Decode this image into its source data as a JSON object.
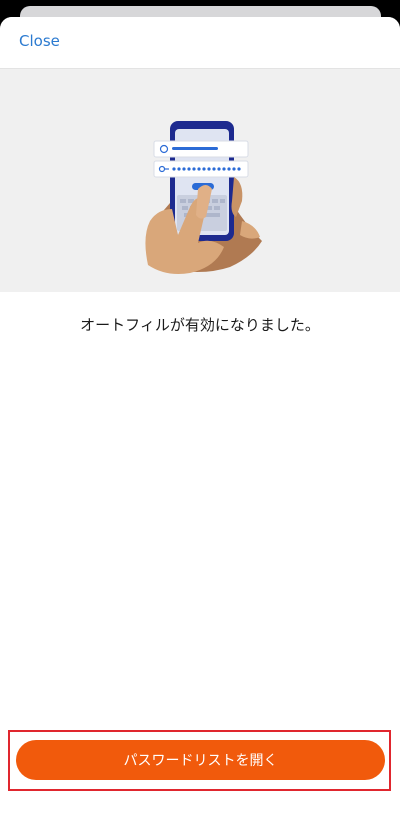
{
  "header": {
    "close_label": "Close"
  },
  "content": {
    "message": "オートフィルが有効になりました。"
  },
  "footer": {
    "primary_button_label": "パスワードリストを開く"
  },
  "colors": {
    "accent_link": "#2b7ad0",
    "primary_button": "#f15a0c",
    "highlight_border": "#e0262e",
    "hero_background": "#f0f0f0"
  },
  "icons": {
    "illustration": "hand-holding-phone-autofill-illustration",
    "user_field_icon": "user-icon",
    "password_field_icon": "key-icon"
  }
}
